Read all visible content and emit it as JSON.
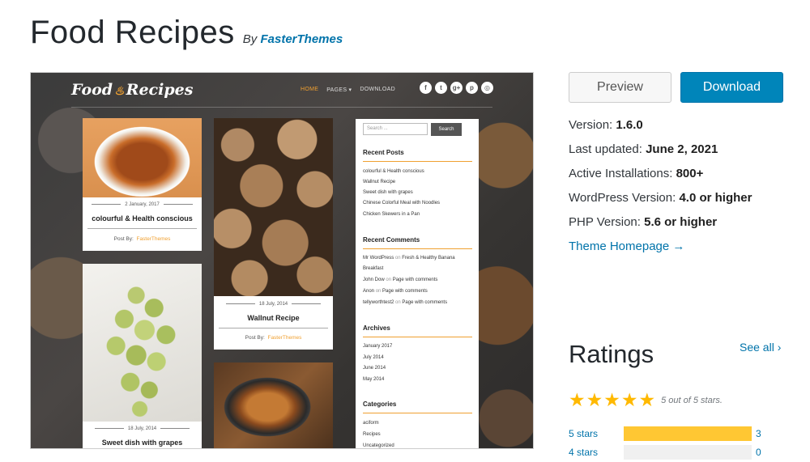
{
  "header": {
    "title": "Food Recipes",
    "by": "By",
    "author": "FasterThemes"
  },
  "screenshot": {
    "logo_left": "Food",
    "logo_right": "Recipes",
    "logo_pot": "♨",
    "nav": [
      "HOME",
      "PAGES ▾",
      "DOWNLOAD"
    ],
    "social": [
      "f",
      "t",
      "g+",
      "p",
      "◎"
    ],
    "posts": [
      {
        "date": "2 January, 2017",
        "title": "colourful & Health conscious",
        "postby": "Post By:",
        "author": "FasterThemes"
      },
      {
        "date": "18 July, 2014",
        "title": "Wallnut Recipe",
        "postby": "Post By:",
        "author": "FasterThemes"
      },
      {
        "date": "18 July, 2014",
        "title": "Sweet dish with grapes"
      }
    ],
    "sidebar": {
      "search_placeholder": "Search ...",
      "search_button": "Search",
      "recent_posts_title": "Recent Posts",
      "recent_posts": [
        "colourful & Health conscious",
        "Wallnut Recipe",
        "Sweet dish with grapes",
        "Chinese Colorful Meal with Noodles",
        "Chicken Skewers in a Pan"
      ],
      "recent_comments_title": "Recent Comments",
      "comments": [
        {
          "who": "Mr WordPress",
          "on": "on",
          "what": "Fresh & Healthy Banana"
        },
        {
          "who": "Breakfast",
          "on": "",
          "what": ""
        },
        {
          "who": "John Dow",
          "on": "on",
          "what": "Page with comments"
        },
        {
          "who": "Anon",
          "on": "on",
          "what": "Page with comments"
        },
        {
          "who": "tellyworthtest2",
          "on": "on",
          "what": "Page with comments"
        }
      ],
      "archives_title": "Archives",
      "archives": [
        "January 2017",
        "July 2014",
        "June 2014",
        "May 2014"
      ],
      "categories_title": "Categories",
      "categories": [
        "aciform",
        "Recipes",
        "Uncategorized"
      ]
    }
  },
  "actions": {
    "preview": "Preview",
    "download": "Download"
  },
  "meta": {
    "version_label": "Version:",
    "version": "1.6.0",
    "updated_label": "Last updated:",
    "updated": "June 2, 2021",
    "installs_label": "Active Installations:",
    "installs": "800+",
    "wp_label": "WordPress Version:",
    "wp": "4.0 or higher",
    "php_label": "PHP Version:",
    "php": "5.6 or higher",
    "homepage": "Theme Homepage →"
  },
  "ratings": {
    "heading": "Ratings",
    "see_all": "See all ›",
    "stars_text": "5 out of 5 stars.",
    "rows": [
      {
        "label": "5 stars",
        "count": "3",
        "fraction": 1.0
      },
      {
        "label": "4 stars",
        "count": "0",
        "fraction": 0.0
      }
    ],
    "star_color": "#ffb900",
    "bar_color": "#ffc733"
  }
}
